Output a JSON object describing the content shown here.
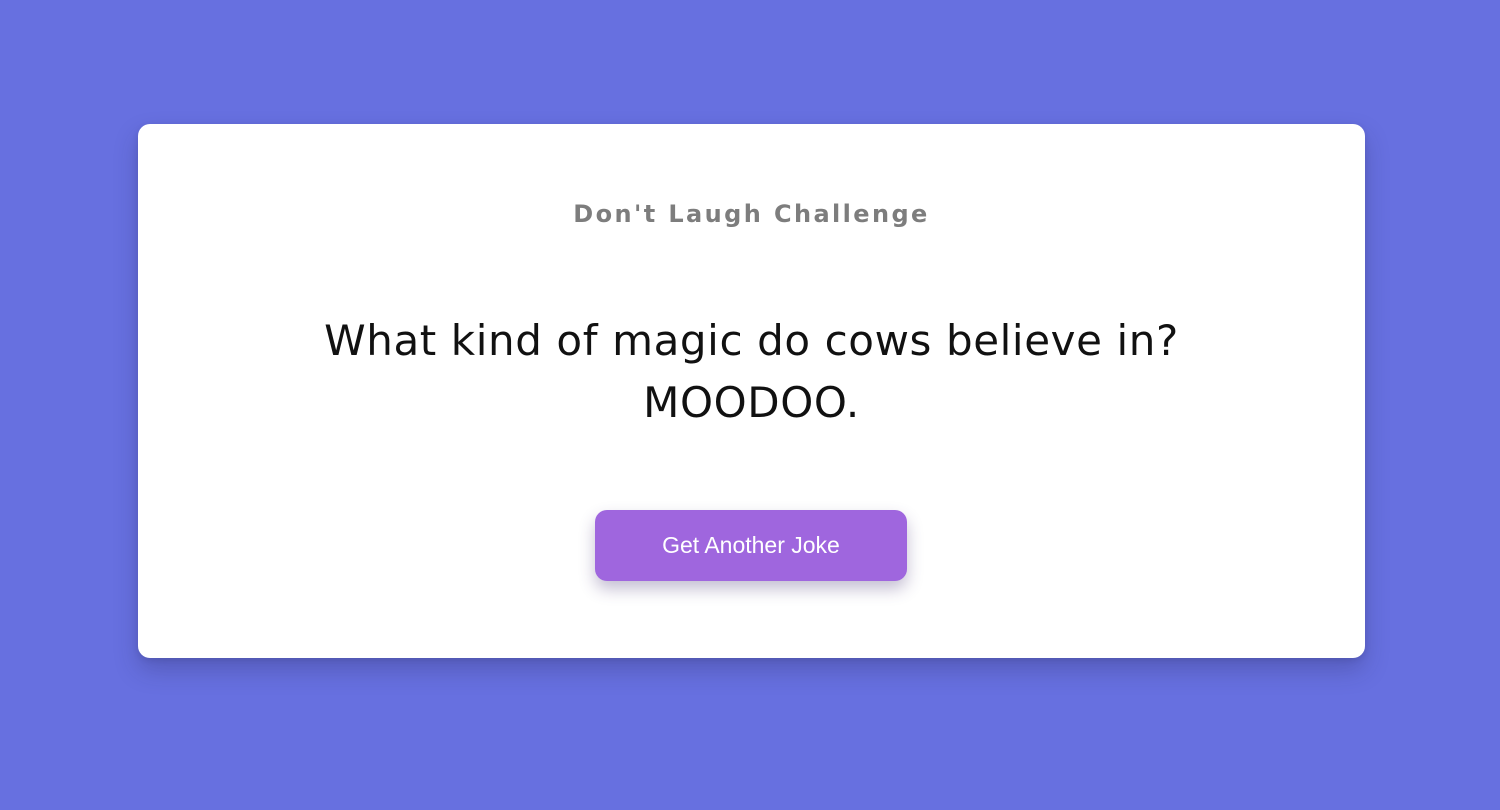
{
  "app": {
    "title": "Don't Laugh Challenge"
  },
  "joke": {
    "setup": "What kind of magic do cows believe in?",
    "punchline": "MOODOO."
  },
  "actions": {
    "next_joke_label": "Get Another Joke"
  },
  "colors": {
    "background": "#6770e0",
    "card": "#ffffff",
    "button": "#9f66de",
    "heading": "#7d7d7d",
    "joke_text": "#111111"
  }
}
